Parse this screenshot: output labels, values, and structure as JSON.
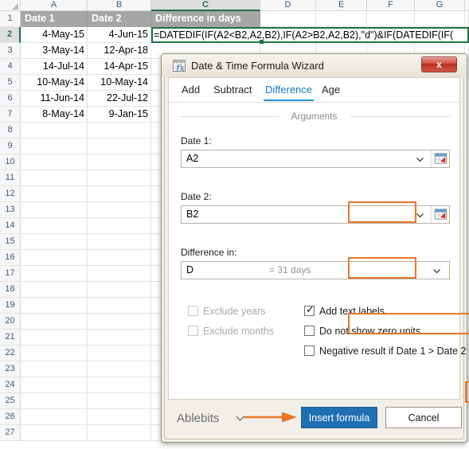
{
  "spreadsheet": {
    "columns": [
      "A",
      "B",
      "C",
      "D",
      "E",
      "F",
      "G"
    ],
    "selected_column": "C",
    "selected_row": "2",
    "rows": [
      "1",
      "2",
      "3",
      "4",
      "5",
      "6",
      "7",
      "8",
      "9",
      "10",
      "11",
      "12",
      "13",
      "14",
      "15",
      "16",
      "17",
      "18",
      "19",
      "20",
      "21",
      "22",
      "23",
      "24",
      "25",
      "26",
      "27"
    ],
    "headers": {
      "a": "Date 1",
      "b": "Date 2",
      "c": "Difference in days"
    },
    "data": [
      {
        "row": "2",
        "a": "4-May-15",
        "b": "4-Jun-15"
      },
      {
        "row": "3",
        "a": "3-May-14",
        "b": "12-Apr-18"
      },
      {
        "row": "4",
        "a": "14-Jul-14",
        "b": "14-Apr-15"
      },
      {
        "row": "5",
        "a": "10-May-14",
        "b": "10-May-14"
      },
      {
        "row": "6",
        "a": "11-Jun-14",
        "b": "22-Jul-12"
      },
      {
        "row": "7",
        "a": "8-May-14",
        "b": "9-Jan-15"
      }
    ],
    "active_cell_formula": "=DATEDIF(IF(A2<B2,A2,B2),IF(A2>B2,A2,B2),\"d\")&IF(DATEDIF(IF(",
    "grid_line_color": "#e3e3e3",
    "header_band_color": "#a6a6a6",
    "selection_color": "#1f7145"
  },
  "dialog": {
    "title": "Date & Time Formula Wizard",
    "title_icon": "formula-wizard-icon",
    "close_label": "x",
    "tabs": [
      {
        "label": "Add",
        "active": false
      },
      {
        "label": "Subtract",
        "active": false
      },
      {
        "label": "Difference",
        "active": true
      },
      {
        "label": "Age",
        "active": false
      }
    ],
    "arguments_label": "Arguments",
    "fields": [
      {
        "label": "Date 1:",
        "value": "A2",
        "hint": "",
        "has_range_picker": true,
        "annotated": true
      },
      {
        "label": "Date 2:",
        "value": "B2",
        "hint": "",
        "has_range_picker": true,
        "annotated": true
      },
      {
        "label": "Difference in:",
        "value": "D",
        "hint": "= 31 days",
        "has_range_picker": false,
        "annotated": true
      }
    ],
    "checkboxes_left": [
      {
        "label": "Exclude years",
        "checked": false,
        "disabled": true,
        "annotated": false
      },
      {
        "label": "Exclude months",
        "checked": false,
        "disabled": true,
        "annotated": false
      }
    ],
    "checkboxes_right": [
      {
        "label": "Add text labels",
        "checked": true,
        "disabled": false,
        "annotated": true
      },
      {
        "label": "Do not show zero units",
        "checked": false,
        "disabled": false,
        "annotated": false
      },
      {
        "label": "Negative result if Date 1 > Date 2",
        "checked": false,
        "disabled": false,
        "annotated": false
      }
    ],
    "footer": {
      "brand": "Ablebits",
      "brand_chevron": "chevron-down-icon",
      "primary_button": "Insert formula",
      "secondary_button": "Cancel"
    }
  },
  "annotations": {
    "accent_color": "#e8762c",
    "arrow": "right-arrow-annotation"
  }
}
